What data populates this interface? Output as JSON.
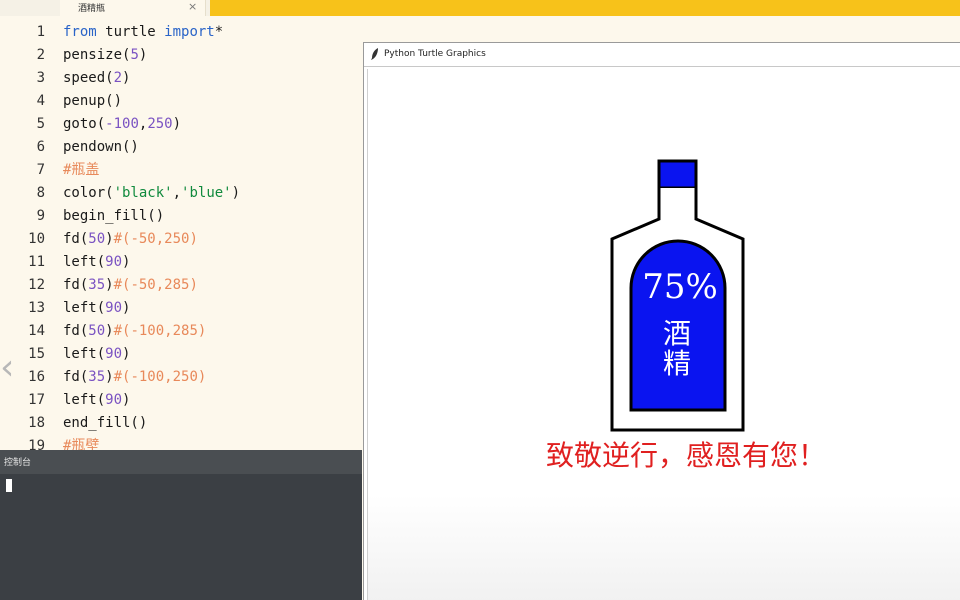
{
  "tab": {
    "label": "酒精瓶",
    "close": "×"
  },
  "editor": {
    "lines": [
      {
        "n": "1",
        "tokens": [
          [
            "kw",
            "from"
          ],
          [
            "t",
            " turtle "
          ],
          [
            "kw",
            "import"
          ],
          [
            "t",
            "*"
          ]
        ]
      },
      {
        "n": "2",
        "tokens": [
          [
            "t",
            "pensize("
          ],
          [
            "num",
            "5"
          ],
          [
            "t",
            ")"
          ]
        ]
      },
      {
        "n": "3",
        "tokens": [
          [
            "t",
            "speed("
          ],
          [
            "num",
            "2"
          ],
          [
            "t",
            ")"
          ]
        ]
      },
      {
        "n": "4",
        "tokens": [
          [
            "t",
            "penup()"
          ]
        ]
      },
      {
        "n": "5",
        "tokens": [
          [
            "t",
            "goto("
          ],
          [
            "num",
            "-100"
          ],
          [
            "t",
            ","
          ],
          [
            "num",
            "250"
          ],
          [
            "t",
            ")"
          ]
        ]
      },
      {
        "n": "6",
        "tokens": [
          [
            "t",
            "pendown()"
          ]
        ]
      },
      {
        "n": "7",
        "tokens": [
          [
            "cm",
            "#瓶盖"
          ]
        ]
      },
      {
        "n": "8",
        "tokens": [
          [
            "t",
            "color("
          ],
          [
            "str",
            "'black'"
          ],
          [
            "t",
            ","
          ],
          [
            "str",
            "'blue'"
          ],
          [
            "t",
            ")"
          ]
        ]
      },
      {
        "n": "9",
        "tokens": [
          [
            "t",
            "begin_fill()"
          ]
        ]
      },
      {
        "n": "10",
        "tokens": [
          [
            "t",
            "fd("
          ],
          [
            "num",
            "50"
          ],
          [
            "t",
            ")"
          ],
          [
            "cm",
            "#(-50,250)"
          ]
        ]
      },
      {
        "n": "11",
        "tokens": [
          [
            "t",
            "left("
          ],
          [
            "num",
            "90"
          ],
          [
            "t",
            ")"
          ]
        ]
      },
      {
        "n": "12",
        "tokens": [
          [
            "t",
            "fd("
          ],
          [
            "num",
            "35"
          ],
          [
            "t",
            ")"
          ],
          [
            "cm",
            "#(-50,285)"
          ]
        ]
      },
      {
        "n": "13",
        "tokens": [
          [
            "t",
            "left("
          ],
          [
            "num",
            "90"
          ],
          [
            "t",
            ")"
          ]
        ]
      },
      {
        "n": "14",
        "tokens": [
          [
            "t",
            "fd("
          ],
          [
            "num",
            "50"
          ],
          [
            "t",
            ")"
          ],
          [
            "cm",
            "#(-100,285)"
          ]
        ]
      },
      {
        "n": "15",
        "tokens": [
          [
            "t",
            "left("
          ],
          [
            "num",
            "90"
          ],
          [
            "t",
            ")"
          ]
        ]
      },
      {
        "n": "16",
        "tokens": [
          [
            "t",
            "fd("
          ],
          [
            "num",
            "35"
          ],
          [
            "t",
            ")"
          ],
          [
            "cm",
            "#(-100,250)"
          ]
        ]
      },
      {
        "n": "17",
        "tokens": [
          [
            "t",
            "left("
          ],
          [
            "num",
            "90"
          ],
          [
            "t",
            ")"
          ]
        ]
      },
      {
        "n": "18",
        "tokens": [
          [
            "t",
            "end_fill()"
          ]
        ]
      },
      {
        "n": "19",
        "tokens": [
          [
            "cm",
            "#瓶壁"
          ]
        ]
      }
    ]
  },
  "console": {
    "title": "控制台"
  },
  "turtle": {
    "title": "Python Turtle Graphics",
    "label_percent": "75%",
    "label_char1": "酒",
    "label_char2": "精",
    "message": "致敬逆行，感恩有您！",
    "colors": {
      "fill": "#0a14f0",
      "outline": "#000000",
      "label_text": "#ffffff",
      "message": "#e02020"
    }
  }
}
